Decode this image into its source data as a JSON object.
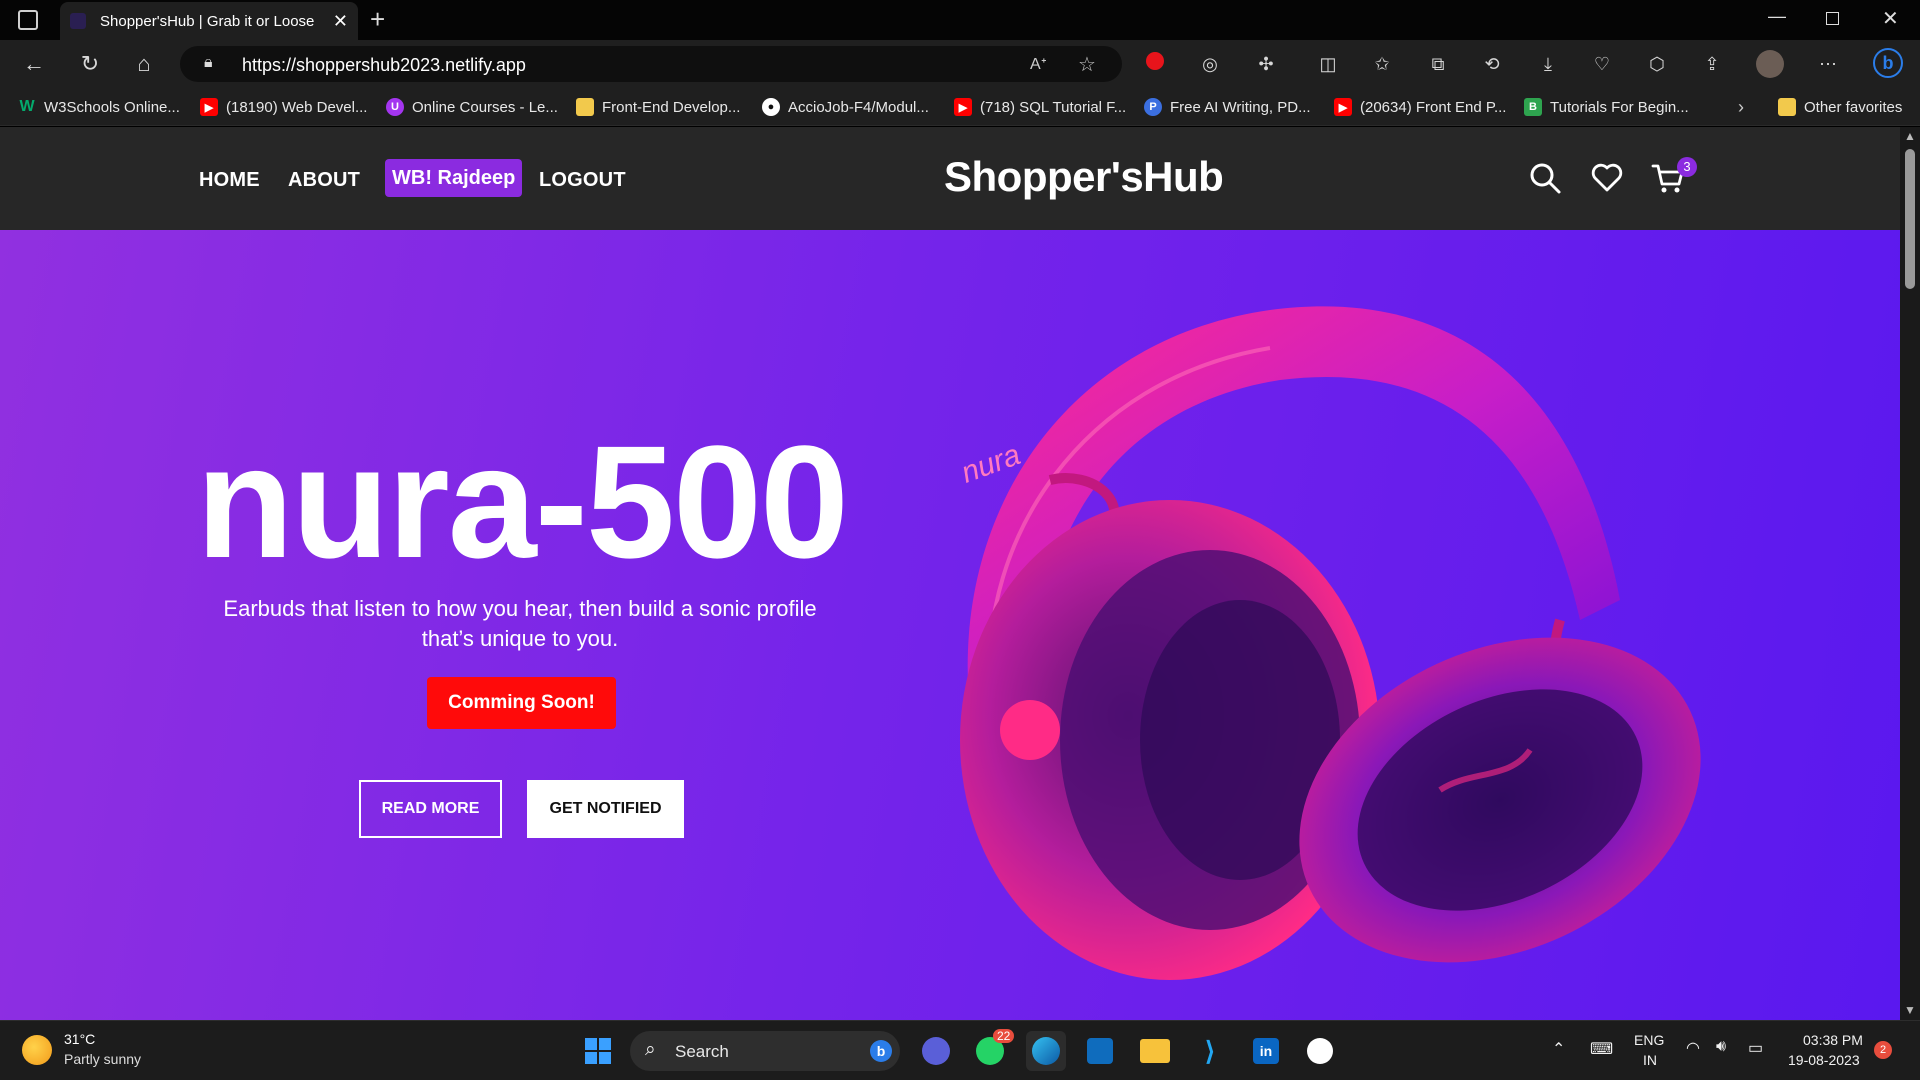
{
  "browser": {
    "tab_title": "Shopper'sHub | Grab it or Loose",
    "url": "https://shoppershub2023.netlify.app",
    "bookmarks": [
      "W3Schools Online...",
      "(18190) Web Devel...",
      "Online Courses - Le...",
      "Front-End Develop...",
      "AccioJob-F4/Modul...",
      "(718) SQL Tutorial F...",
      "Free AI Writing, PD...",
      "(20634) Front End P...",
      "Tutorials For Begin...",
      "Other favorites"
    ]
  },
  "site": {
    "nav": {
      "home": "HOME",
      "about": "ABOUT",
      "greeting": "WB! Rajdeep",
      "logout": "LOGOUT"
    },
    "brand": "Shopper'sHub",
    "cart_count": "3",
    "hero": {
      "title": "nura-500",
      "description": "Earbuds that listen to how you hear, then build a sonic profile that’s unique to you.",
      "cta": "Comming Soon!",
      "read_more": "READ MORE",
      "get_notified": "GET NOTIFIED",
      "product_brand_on_image": "nura"
    },
    "colors": {
      "accent": "#8b2be0",
      "cta": "#ff0a0a",
      "hero_gradient_start": "#9130e0",
      "hero_gradient_end": "#5a18ef"
    }
  },
  "taskbar": {
    "weather_temp": "31°C",
    "weather_desc": "Partly sunny",
    "search_label": "Search",
    "whatsapp_badge": "22",
    "language": "ENG",
    "region": "IN",
    "time": "03:38 PM",
    "date": "19-08-2023",
    "notifications": "2"
  }
}
